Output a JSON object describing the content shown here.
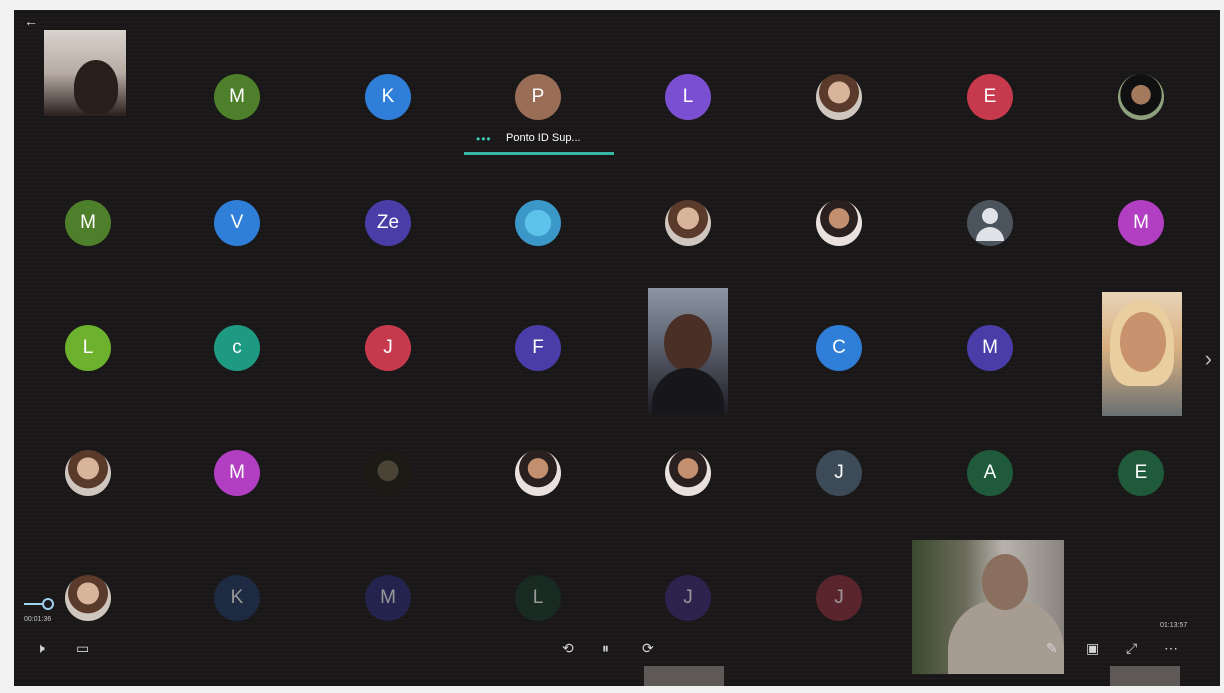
{
  "screen": {
    "back_label": "←",
    "next_label": "›",
    "speaker": {
      "dots": "•••",
      "name": "Ponto ID Sup..."
    },
    "time_elapsed": "00:01:36",
    "time_total": "01:13:57"
  },
  "participants": [
    {
      "kind": "video",
      "name": "video-tile-1"
    },
    {
      "kind": "initial",
      "letter": "M",
      "color": "#4e7f2a"
    },
    {
      "kind": "initial",
      "letter": "K",
      "color": "#2f7fd8"
    },
    {
      "kind": "initial",
      "letter": "P",
      "color": "#9a6d57"
    },
    {
      "kind": "initial",
      "letter": "L",
      "color": "#7a4fd1"
    },
    {
      "kind": "photo",
      "style": "a"
    },
    {
      "kind": "initial",
      "letter": "E",
      "color": "#c73a4d"
    },
    {
      "kind": "photo",
      "style": "c"
    },
    {
      "kind": "initial",
      "letter": "M",
      "color": "#4e7f2a"
    },
    {
      "kind": "initial",
      "letter": "V",
      "color": "#2f7fd8"
    },
    {
      "kind": "initial",
      "letter": "Ze",
      "color": "#4b3da8"
    },
    {
      "kind": "photo",
      "style": "sea"
    },
    {
      "kind": "photo",
      "style": "a"
    },
    {
      "kind": "photo",
      "style": "b"
    },
    {
      "kind": "generic"
    },
    {
      "kind": "initial",
      "letter": "M",
      "color": "#b23fc2"
    },
    {
      "kind": "initial",
      "letter": "L",
      "color": "#6db12f"
    },
    {
      "kind": "initial",
      "letter": "c",
      "color": "#1f9a82"
    },
    {
      "kind": "initial",
      "letter": "J",
      "color": "#c73a4d"
    },
    {
      "kind": "initial",
      "letter": "F",
      "color": "#4b3da8"
    },
    {
      "kind": "video",
      "name": "video-tile-2"
    },
    {
      "kind": "initial",
      "letter": "C",
      "color": "#2f7fd8"
    },
    {
      "kind": "initial",
      "letter": "M",
      "color": "#4b3da8"
    },
    {
      "kind": "video",
      "name": "video-tile-3"
    },
    {
      "kind": "photo",
      "style": "a"
    },
    {
      "kind": "initial",
      "letter": "M",
      "color": "#b23fc2"
    },
    {
      "kind": "photo",
      "style": "dark"
    },
    {
      "kind": "photo",
      "style": "b"
    },
    {
      "kind": "photo",
      "style": "b"
    },
    {
      "kind": "initial",
      "letter": "J",
      "color": "#3d4a57"
    },
    {
      "kind": "initial",
      "letter": "A",
      "color": "#1f5a3a"
    },
    {
      "kind": "initial",
      "letter": "E",
      "color": "#1f5a3a"
    },
    {
      "kind": "photo",
      "style": "a"
    },
    {
      "kind": "initial",
      "letter": "K",
      "color": "#203a63",
      "dim": true
    },
    {
      "kind": "initial",
      "letter": "M",
      "color": "#2c2e7a",
      "dim": true
    },
    {
      "kind": "initial",
      "letter": "L",
      "color": "#183a2a",
      "dim": true
    },
    {
      "kind": "initial",
      "letter": "J",
      "color": "#3a2c7a",
      "dim": true
    },
    {
      "kind": "initial",
      "letter": "J",
      "color": "#8e2f3d",
      "dim": true
    },
    {
      "kind": "video",
      "name": "video-tile-4"
    }
  ],
  "controls": {
    "volume_icon": "🕨",
    "chat_icon": "▭",
    "rewind_icon": "⟲",
    "pause_icon": "⏸",
    "forward_icon": "⟳",
    "edit_icon": "✎",
    "pip_icon": "▣",
    "fullscreen_icon": "⤢",
    "more_icon": "⋯"
  }
}
